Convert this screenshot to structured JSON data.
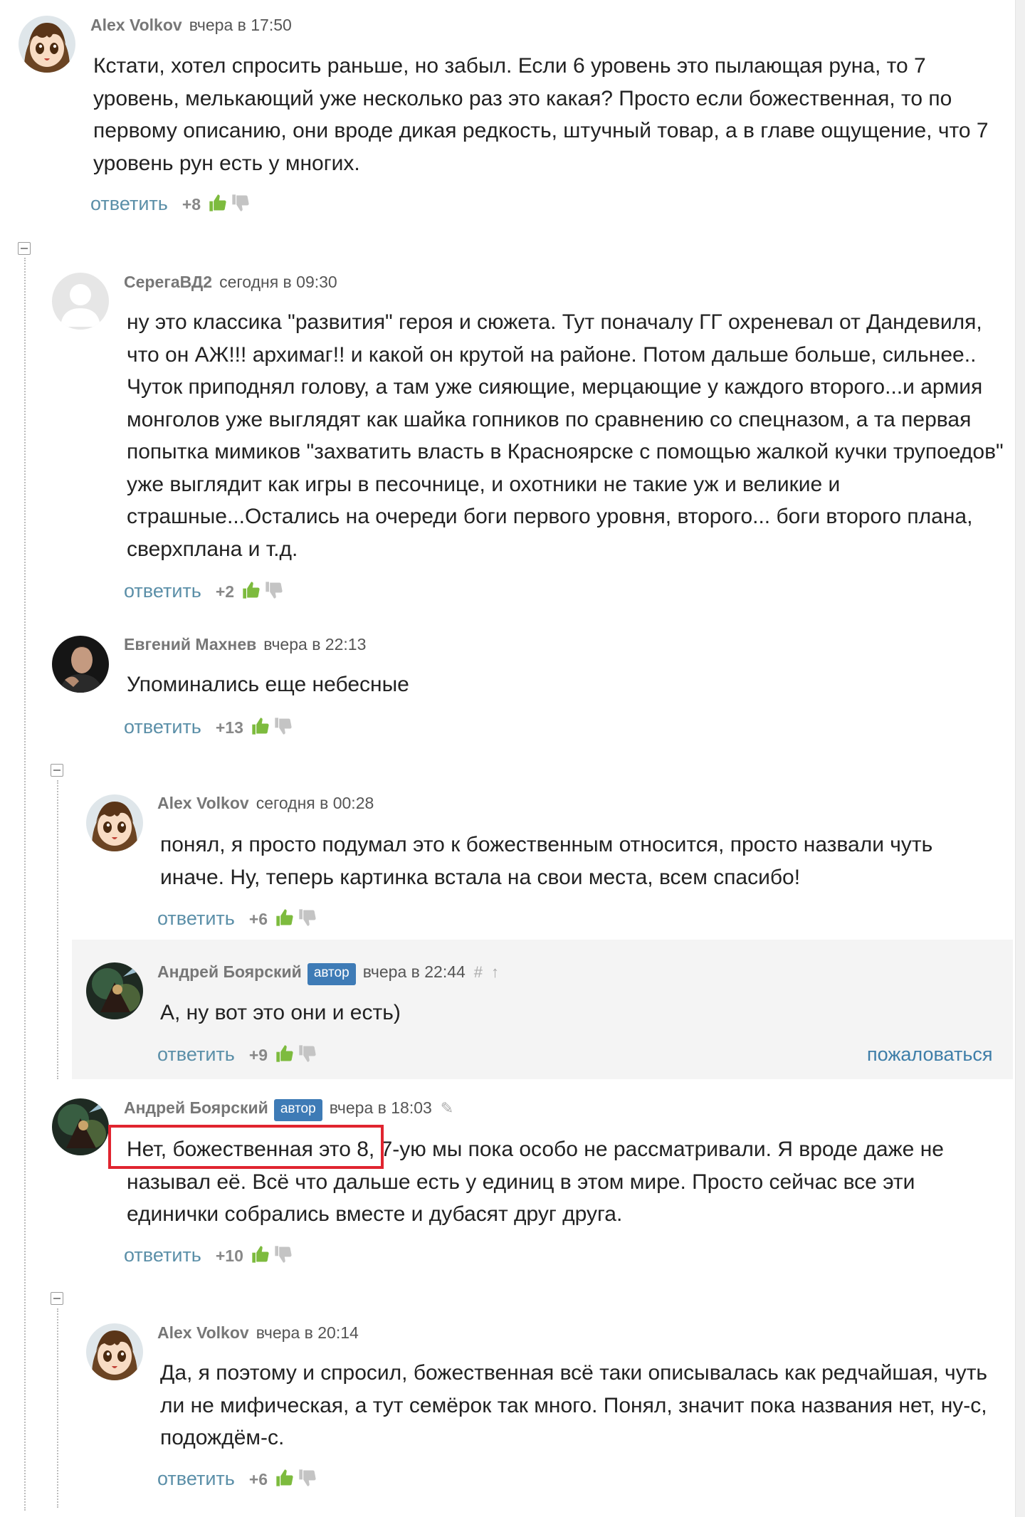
{
  "colors": {
    "reply_link": "#5b8fa8",
    "report_link": "#3e7ea8",
    "author_badge": "#3e7bb6",
    "thumb_up": "#7dbb3e",
    "thumb_down": "#c4c4c4",
    "highlight_box": "#e0242f",
    "thread_line": "#bcbcbc"
  },
  "labels": {
    "reply": "ответить",
    "author_badge": "автор",
    "report": "пожаловаться"
  },
  "comments": [
    {
      "author": "Alex Volkov",
      "date": "вчера в 17:50",
      "text": "Кстати, хотел спросить раньше, но забыл. Если 6 уровень это пылающая руна, то 7 уровень, мелькающий уже несколько раз это какая? Просто если божественная, то по первому описанию, они вроде дикая редкость, штучный товар, а в главе ощущение, что 7 уровень рун есть у многих.",
      "score": "+8",
      "avatar_icon": "anime-girl-avatar"
    },
    {
      "author": "СерегаВД2",
      "date": "сегодня в 09:30",
      "text": "ну это классика \"развития\" героя и сюжета. Тут поначалу ГГ охреневал от Дандевиля, что он АЖ!!! архимаг!! и какой он крутой на районе. Потом дальше больше, сильнее.. Чуток приподнял голову, а там уже сияющие, мерцающие у каждого второго...и армия монголов уже выглядят как шайка гопников по сравнению со спецназом, а та первая попытка  мимиков \"захватить власть в Красноярске с помощью жалкой кучки трупоедов\" уже выглядит как игры в песочнице, и охотники не такие уж и великие и страшные...Остались на очереди боги первого уровня, второго... боги второго плана, сверхплана и т.д.",
      "score": "+2",
      "avatar_icon": "default-user-avatar"
    },
    {
      "author": "Евгений Махнев",
      "date": "вчера в 22:13",
      "text": "Упоминались еще небесные",
      "score": "+13",
      "avatar_icon": "man-photo-avatar"
    },
    {
      "author": "Alex Volkov",
      "date": "сегодня в 00:28",
      "text": "понял, я просто подумал это к божественным относится, просто назвали чуть иначе. Ну, теперь картинка встала на свои места, всем спасибо!",
      "score": "+6",
      "avatar_icon": "anime-girl-avatar"
    },
    {
      "author": "Андрей Боярский",
      "date": "вчера в 22:44",
      "meta_icons": [
        "#",
        "↑"
      ],
      "text": "А, ну вот это они и есть)",
      "score": "+9",
      "avatar_icon": "fantasy-art-avatar"
    },
    {
      "author": "Андрей Боярский",
      "date": "вчера в 18:03",
      "meta_icons": [
        "✎"
      ],
      "text": "Нет, божественная это 8, 7-ую мы пока особо не рассматривали. Я вроде даже не называл её. Всё что дальше есть у единиц в этом мире. Просто сейчас все эти единички собрались вместе и дубасят друг друга.",
      "score": "+10",
      "avatar_icon": "fantasy-art-avatar"
    },
    {
      "author": "Alex Volkov",
      "date": "вчера в 20:14",
      "text": "Да, я поэтому и спросил, божественная всё таки описывалась как редчайшая, чуть ли не мифическая, а тут семёрок так много. Понял, значит пока названия нет, ну-с, подождём-с.",
      "score": "+6",
      "avatar_icon": "anime-girl-avatar"
    }
  ]
}
